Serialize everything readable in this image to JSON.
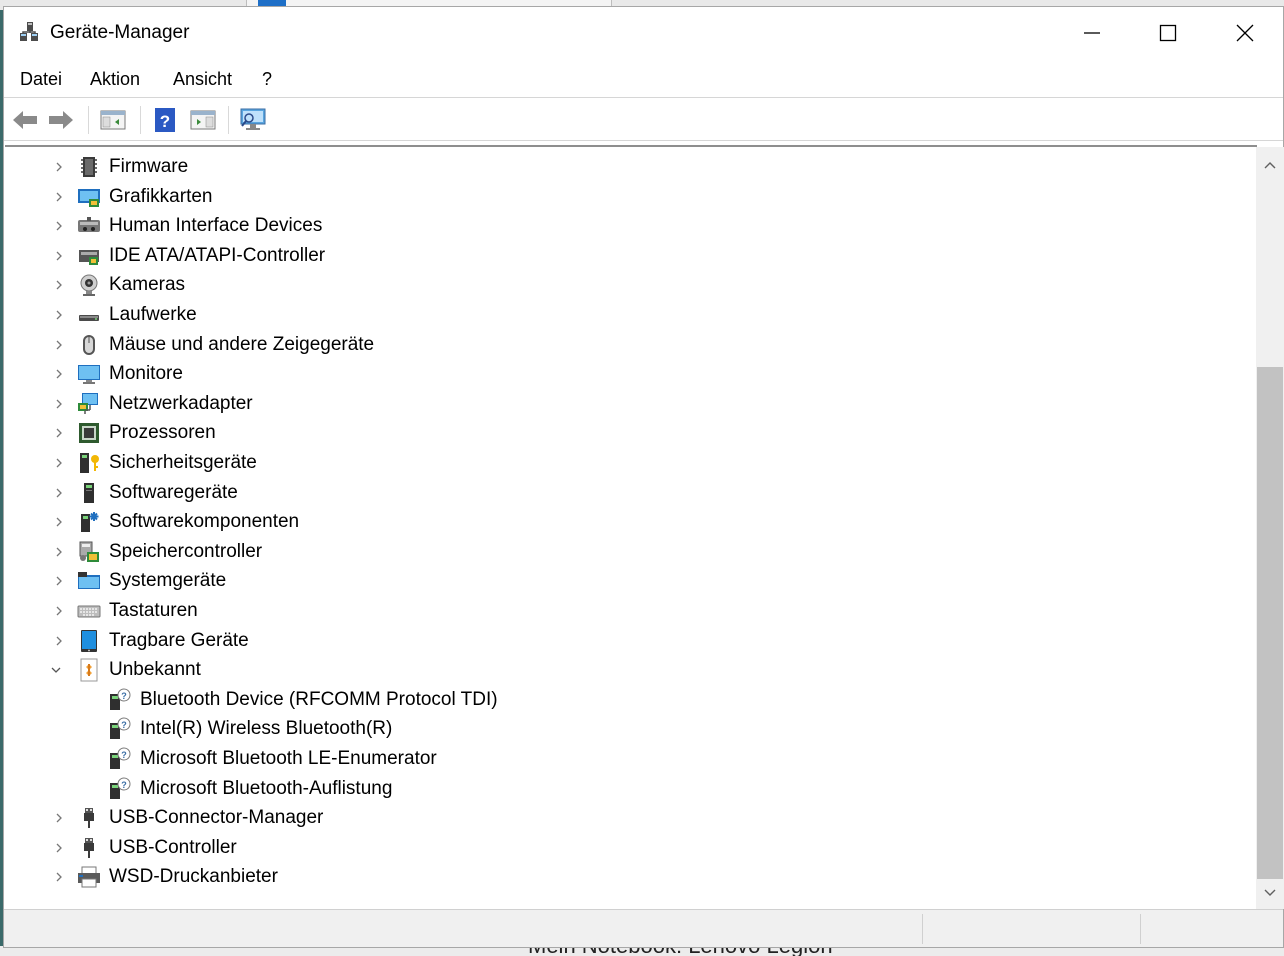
{
  "window": {
    "title": "Geräte-Manager"
  },
  "background": {
    "bottom_text": "Mein Notebook: Lenovo Legion"
  },
  "menu": [
    "Datei",
    "Aktion",
    "Ansicht",
    "?"
  ],
  "toolbar": {
    "buttons": [
      "back-arrow-icon",
      "forward-arrow-icon",
      "show-hide-console-tree-icon",
      "help-icon",
      "action-pane-icon",
      "scan-hardware-icon"
    ]
  },
  "tree": [
    {
      "label": "Firmware",
      "icon": "firmware-icon",
      "expanded": false,
      "depth": 0
    },
    {
      "label": "Grafikkarten",
      "icon": "display-adapter-icon",
      "expanded": false,
      "depth": 0
    },
    {
      "label": "Human Interface Devices",
      "icon": "hid-icon",
      "expanded": false,
      "depth": 0
    },
    {
      "label": "IDE ATA/ATAPI-Controller",
      "icon": "ide-controller-icon",
      "expanded": false,
      "depth": 0
    },
    {
      "label": "Kameras",
      "icon": "camera-icon",
      "expanded": false,
      "depth": 0
    },
    {
      "label": "Laufwerke",
      "icon": "disk-drive-icon",
      "expanded": false,
      "depth": 0
    },
    {
      "label": "Mäuse und andere Zeigegeräte",
      "icon": "mouse-icon",
      "expanded": false,
      "depth": 0
    },
    {
      "label": "Monitore",
      "icon": "monitor-icon",
      "expanded": false,
      "depth": 0
    },
    {
      "label": "Netzwerkadapter",
      "icon": "network-adapter-icon",
      "expanded": false,
      "depth": 0
    },
    {
      "label": "Prozessoren",
      "icon": "processor-icon",
      "expanded": false,
      "depth": 0
    },
    {
      "label": "Sicherheitsgeräte",
      "icon": "security-device-icon",
      "expanded": false,
      "depth": 0
    },
    {
      "label": "Softwaregeräte",
      "icon": "software-device-icon",
      "expanded": false,
      "depth": 0
    },
    {
      "label": "Softwarekomponenten",
      "icon": "software-component-icon",
      "expanded": false,
      "depth": 0
    },
    {
      "label": "Speichercontroller",
      "icon": "storage-controller-icon",
      "expanded": false,
      "depth": 0
    },
    {
      "label": "Systemgeräte",
      "icon": "system-device-icon",
      "expanded": false,
      "depth": 0
    },
    {
      "label": "Tastaturen",
      "icon": "keyboard-icon",
      "expanded": false,
      "depth": 0
    },
    {
      "label": "Tragbare Geräte",
      "icon": "portable-device-icon",
      "expanded": false,
      "depth": 0
    },
    {
      "label": "Unbekannt",
      "icon": "unknown-device-icon",
      "expanded": true,
      "depth": 0
    },
    {
      "label": "Bluetooth Device (RFCOMM Protocol TDI)",
      "icon": "unknown-device-warning-icon",
      "depth": 1
    },
    {
      "label": "Intel(R) Wireless Bluetooth(R)",
      "icon": "unknown-device-warning-icon",
      "depth": 1
    },
    {
      "label": "Microsoft Bluetooth LE-Enumerator",
      "icon": "unknown-device-warning-icon",
      "depth": 1
    },
    {
      "label": "Microsoft Bluetooth-Auflistung",
      "icon": "unknown-device-warning-icon",
      "depth": 1
    },
    {
      "label": "USB-Connector-Manager",
      "icon": "usb-icon",
      "expanded": false,
      "depth": 0
    },
    {
      "label": "USB-Controller",
      "icon": "usb-icon",
      "expanded": false,
      "depth": 0
    },
    {
      "label": "WSD-Druckanbieter",
      "icon": "printer-icon",
      "expanded": false,
      "depth": 0
    }
  ]
}
